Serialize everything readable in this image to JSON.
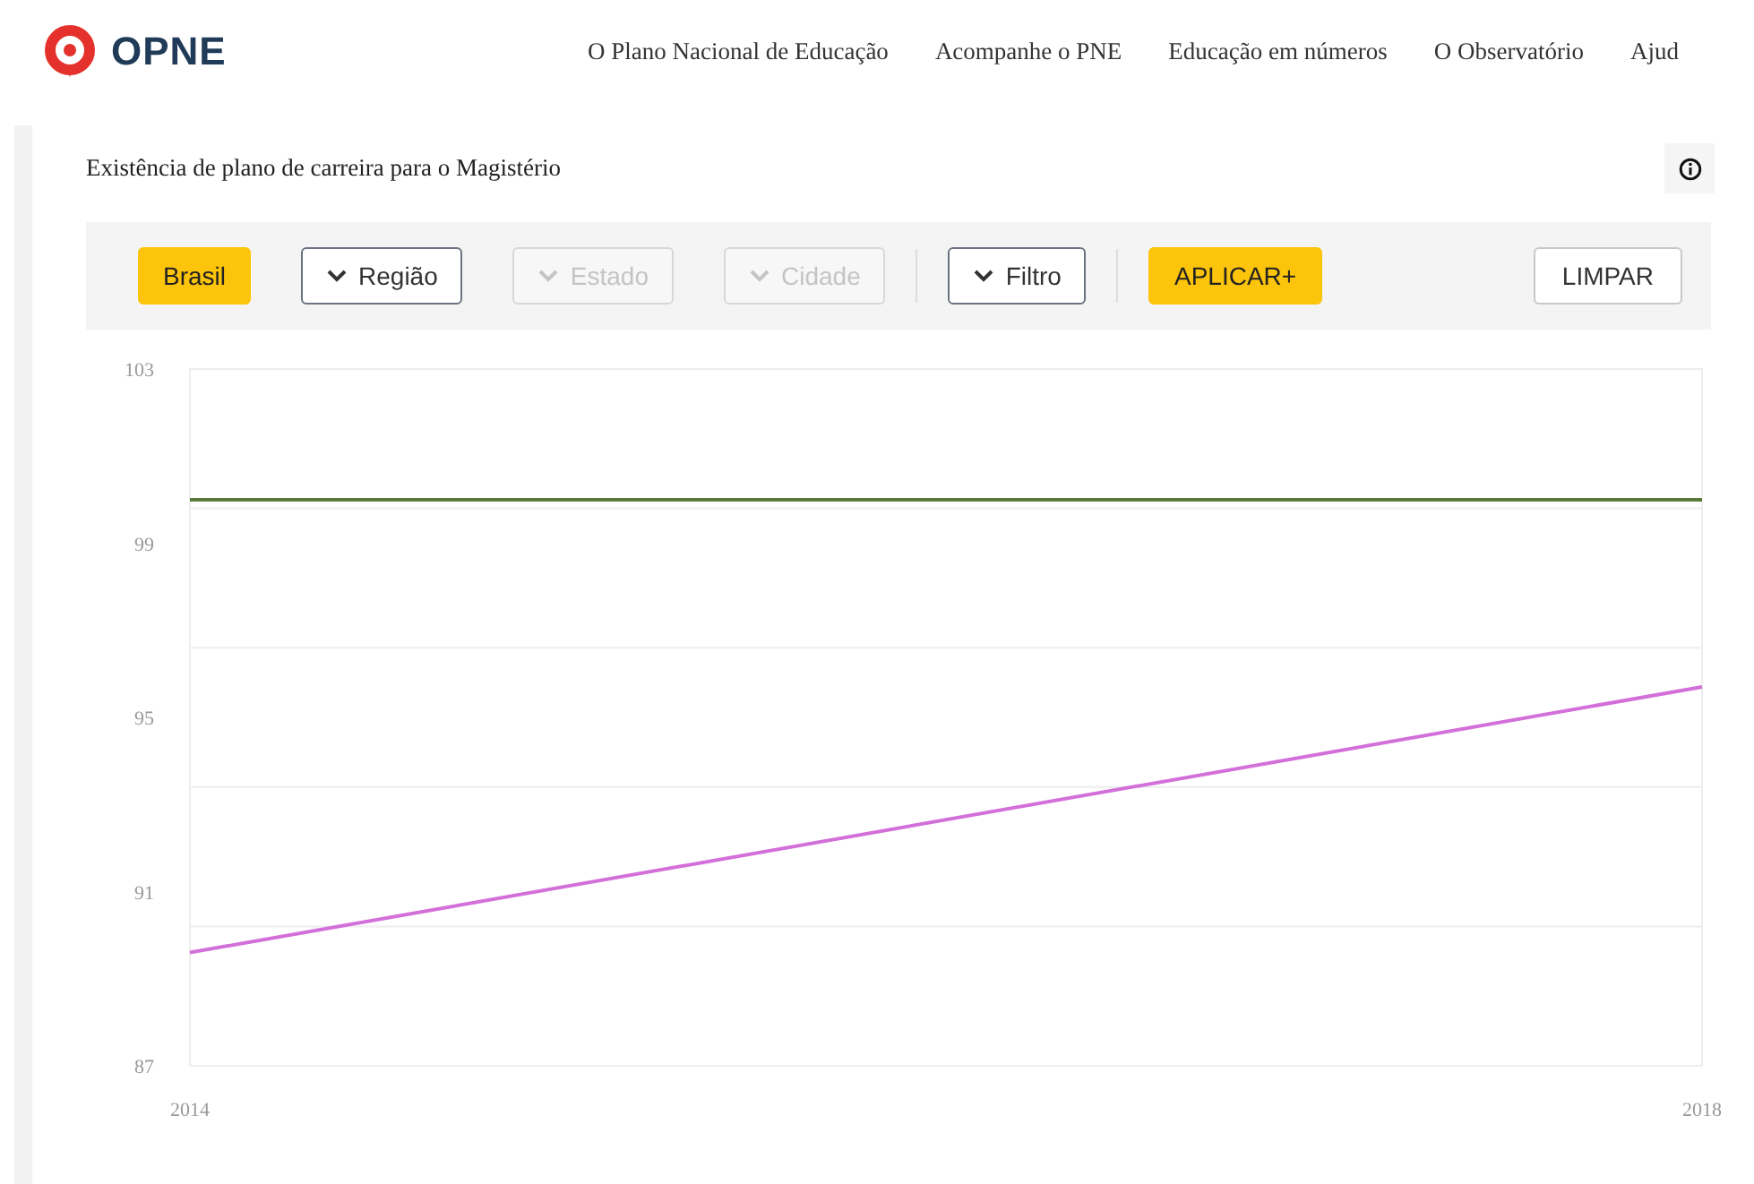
{
  "header": {
    "logo": "OPNE",
    "nav": [
      "O Plano Nacional de Educação",
      "Acompanhe o PNE",
      "Educação em números",
      "O Observatório",
      "Ajud"
    ]
  },
  "card": {
    "title": "Existência de plano de carreira para o Magistério",
    "toolbar": {
      "groups": [
        [
          {
            "kind": "primary",
            "label": "Brasil",
            "disabled": false
          },
          {
            "kind": "dropdown",
            "label": "Região",
            "disabled": false
          },
          {
            "kind": "dropdown",
            "label": "Estado",
            "disabled": true
          },
          {
            "kind": "dropdown",
            "label": "Cidade",
            "disabled": true
          }
        ],
        [
          {
            "kind": "dropdown",
            "label": "Filtro",
            "disabled": false
          }
        ],
        [
          {
            "kind": "primary",
            "label": "APLICAR+",
            "disabled": false
          }
        ]
      ],
      "clear": "LIMPAR"
    },
    "chart_data": {
      "type": "line",
      "x": [
        2014,
        2018
      ],
      "xlim": [
        2014,
        2018
      ],
      "xticks": [
        2014,
        2018
      ],
      "ylim": [
        87,
        103
      ],
      "yticks": [
        87,
        91,
        95,
        99,
        103
      ],
      "series": [
        {
          "color": "#5a7a3a",
          "values": [
            100,
            100
          ]
        },
        {
          "color": "#d36fd9",
          "values": [
            89.6,
            95.7
          ]
        }
      ]
    }
  }
}
